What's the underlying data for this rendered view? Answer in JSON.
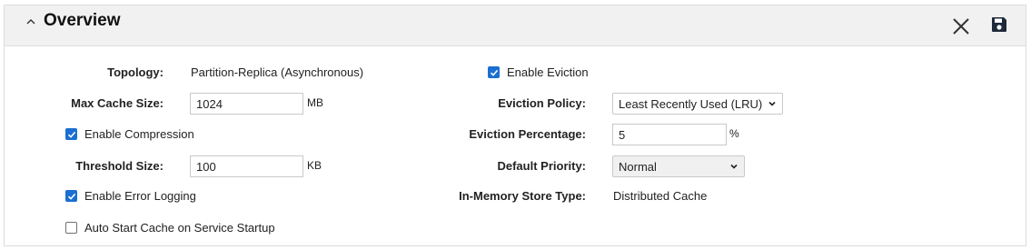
{
  "panel": {
    "title": "Overview"
  },
  "icons": {
    "collapse": "chevron-up-icon",
    "close": "close-icon",
    "save": "save-icon"
  },
  "colors": {
    "checkbox_accent": "#1a6fd1",
    "header_bg": "#f1f1f1"
  },
  "left": {
    "topology_label": "Topology:",
    "topology_value": "Partition-Replica (Asynchronous)",
    "max_cache_label": "Max Cache Size:",
    "max_cache_value": "1024",
    "max_cache_unit": "MB",
    "enable_compression_label": "Enable Compression",
    "enable_compression_checked": true,
    "threshold_label": "Threshold Size:",
    "threshold_value": "100",
    "threshold_unit": "KB",
    "enable_error_logging_label": "Enable Error Logging",
    "enable_error_logging_checked": true,
    "auto_start_label": "Auto Start Cache on Service Startup",
    "auto_start_checked": false
  },
  "right": {
    "enable_eviction_label": "Enable Eviction",
    "enable_eviction_checked": true,
    "eviction_policy_label": "Eviction Policy:",
    "eviction_policy_value": "Least Recently Used (LRU)",
    "eviction_percentage_label": "Eviction Percentage:",
    "eviction_percentage_value": "5",
    "eviction_percentage_unit": "%",
    "default_priority_label": "Default Priority:",
    "default_priority_value": "Normal",
    "store_type_label": "In-Memory Store Type:",
    "store_type_value": "Distributed Cache"
  }
}
